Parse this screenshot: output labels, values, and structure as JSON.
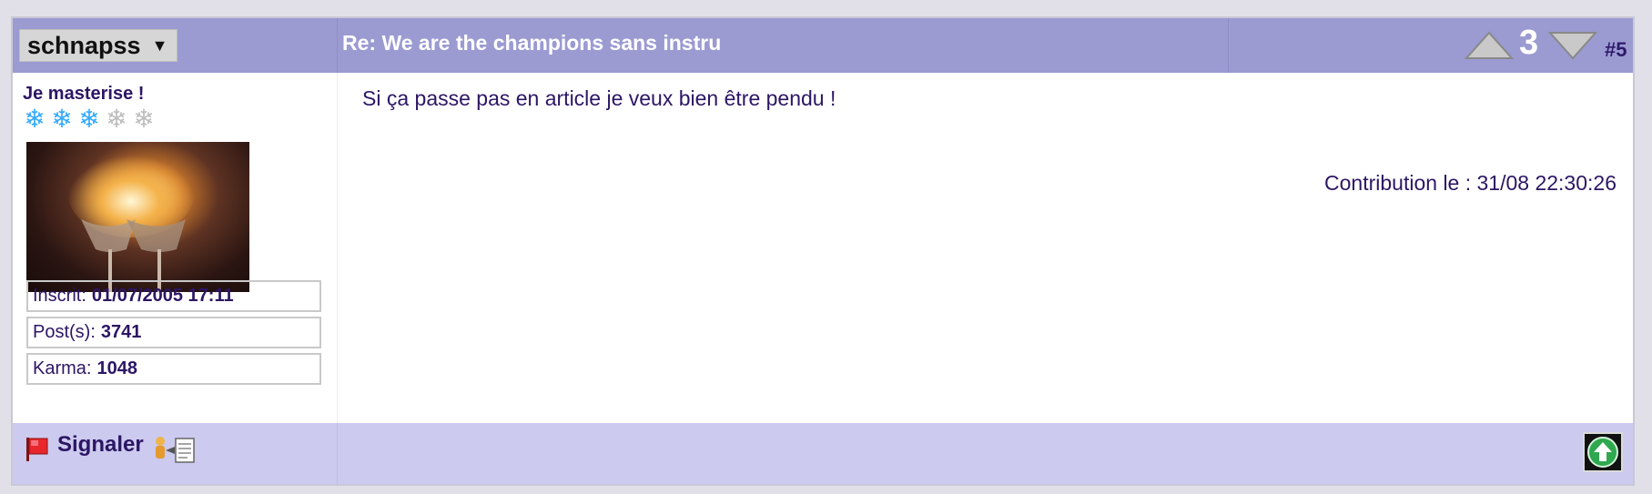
{
  "header": {
    "username": "schnapss",
    "caret": "▼",
    "title": "Re: We are the champions sans instru",
    "vote_count": "3",
    "post_number": "#5",
    "vote_up_icon": "triangle-up-icon",
    "vote_down_icon": "triangle-down-icon"
  },
  "author": {
    "rank": "Je masterise !",
    "rating": {
      "value": 3,
      "max": 5,
      "icon": "snowflake-icon"
    },
    "avatar_description_icon": "avatar-image",
    "info": [
      {
        "label": "Inscrit:",
        "value": "01/07/2005 17:11"
      },
      {
        "label": "Post(s):",
        "value": "3741"
      },
      {
        "label": "Karma:",
        "value": "1048"
      }
    ]
  },
  "post": {
    "message": "Si ça passe pas en article je veux bien être pendu !",
    "timestamp": "Contribution le : 31/08 22:30:26"
  },
  "footer": {
    "report_label": "Signaler",
    "flag_icon": "flag-icon",
    "quote_icon": "quote-icon",
    "top_icon": "arrow-up-icon"
  },
  "colors": {
    "header_bg": "#9b9bd2",
    "footer_bg": "#cccaef",
    "text": "#2c1664",
    "snow_on": "#33aaff",
    "snow_off": "#bdbdbd",
    "top_button_green": "#2fa84f"
  }
}
